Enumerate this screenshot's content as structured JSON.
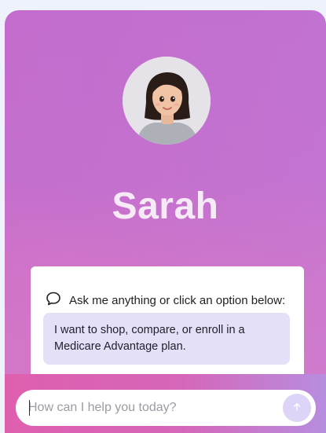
{
  "assistant": {
    "name": "Sarah"
  },
  "chat": {
    "prompt": "Ask me anything or click an option below:",
    "options": [
      "I want to shop, compare, or enroll in a Medicare Advantage plan."
    ]
  },
  "input": {
    "placeholder": "How can I help you today?"
  },
  "colors": {
    "card_gradient_top": "#c36ccd",
    "option_bg": "#e3e0f8",
    "footer_gradient_start": "#df5fae",
    "footer_gradient_end": "#b78ddf",
    "send_button": "#ddd4f7"
  },
  "icons": {
    "prompt": "chat-bubble-icon",
    "send": "arrow-up-icon"
  }
}
